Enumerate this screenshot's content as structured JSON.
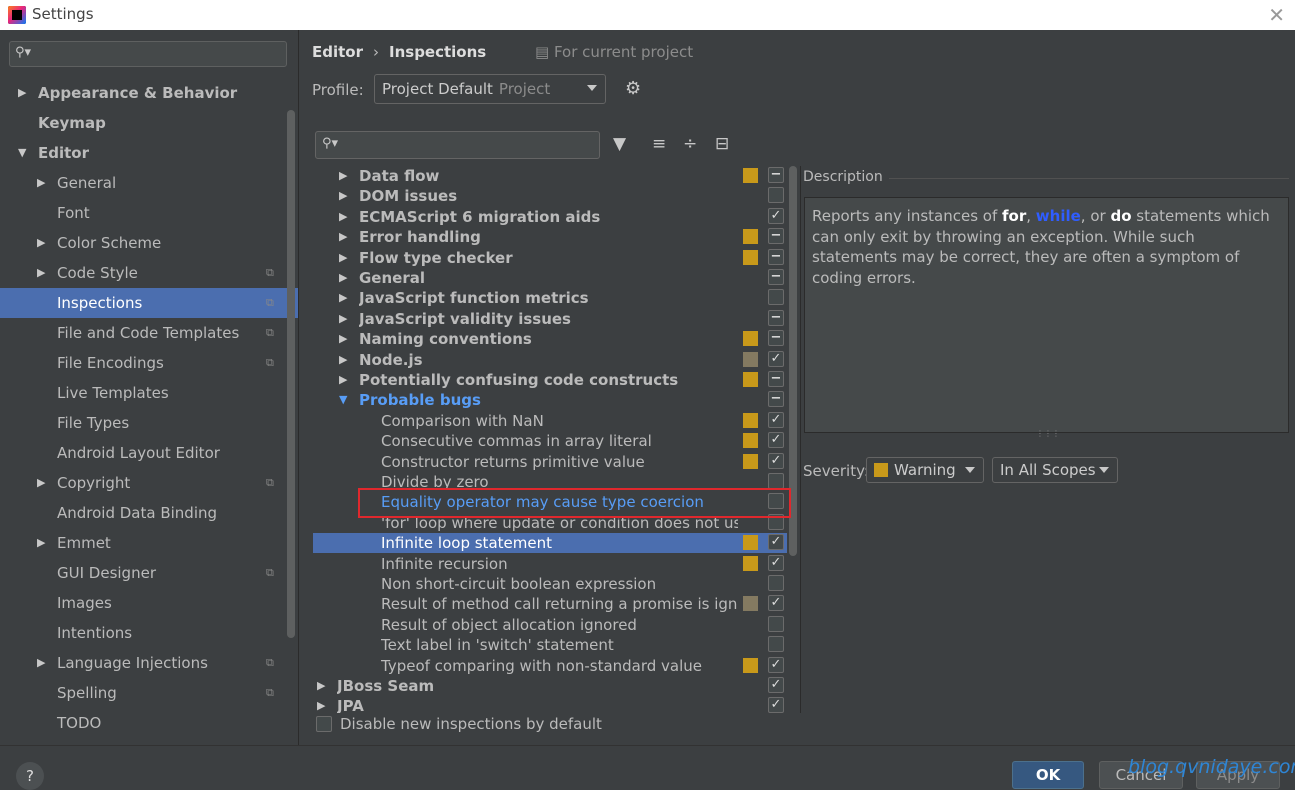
{
  "window": {
    "title": "Settings",
    "close_glyph": "✕"
  },
  "sidebar": {
    "search_placeholder": "",
    "items": [
      {
        "label": "Appearance & Behavior",
        "arrow": "▶",
        "bold": true,
        "indent": 0,
        "shared": false
      },
      {
        "label": "Keymap",
        "arrow": "",
        "bold": true,
        "indent": 0,
        "shared": false
      },
      {
        "label": "Editor",
        "arrow": "▼",
        "bold": true,
        "indent": 0,
        "shared": false
      },
      {
        "label": "General",
        "arrow": "▶",
        "bold": false,
        "indent": 1,
        "shared": false
      },
      {
        "label": "Font",
        "arrow": "",
        "bold": false,
        "indent": 1,
        "shared": false
      },
      {
        "label": "Color Scheme",
        "arrow": "▶",
        "bold": false,
        "indent": 1,
        "shared": false
      },
      {
        "label": "Code Style",
        "arrow": "▶",
        "bold": false,
        "indent": 1,
        "shared": true
      },
      {
        "label": "Inspections",
        "arrow": "",
        "bold": false,
        "indent": 1,
        "shared": true,
        "selected": true
      },
      {
        "label": "File and Code Templates",
        "arrow": "",
        "bold": false,
        "indent": 1,
        "shared": true
      },
      {
        "label": "File Encodings",
        "arrow": "",
        "bold": false,
        "indent": 1,
        "shared": true
      },
      {
        "label": "Live Templates",
        "arrow": "",
        "bold": false,
        "indent": 1,
        "shared": false
      },
      {
        "label": "File Types",
        "arrow": "",
        "bold": false,
        "indent": 1,
        "shared": false
      },
      {
        "label": "Android Layout Editor",
        "arrow": "",
        "bold": false,
        "indent": 1,
        "shared": false
      },
      {
        "label": "Copyright",
        "arrow": "▶",
        "bold": false,
        "indent": 1,
        "shared": true
      },
      {
        "label": "Android Data Binding",
        "arrow": "",
        "bold": false,
        "indent": 1,
        "shared": false
      },
      {
        "label": "Emmet",
        "arrow": "▶",
        "bold": false,
        "indent": 1,
        "shared": false
      },
      {
        "label": "GUI Designer",
        "arrow": "",
        "bold": false,
        "indent": 1,
        "shared": true
      },
      {
        "label": "Images",
        "arrow": "",
        "bold": false,
        "indent": 1,
        "shared": false
      },
      {
        "label": "Intentions",
        "arrow": "",
        "bold": false,
        "indent": 1,
        "shared": false
      },
      {
        "label": "Language Injections",
        "arrow": "▶",
        "bold": false,
        "indent": 1,
        "shared": true
      },
      {
        "label": "Spelling",
        "arrow": "",
        "bold": false,
        "indent": 1,
        "shared": true
      },
      {
        "label": "TODO",
        "arrow": "",
        "bold": false,
        "indent": 1,
        "shared": false
      }
    ]
  },
  "header": {
    "crumb_parent": "Editor",
    "crumb_sep": "›",
    "crumb_current": "Inspections",
    "scope_note": "For current project",
    "profile_label": "Profile:",
    "profile_value": "Project Default",
    "profile_kind": "Project"
  },
  "inspections": {
    "rows": [
      {
        "label": "Data flow",
        "level": 0,
        "arrow": "▶",
        "cat": true,
        "sev": "#c8991a",
        "chk": "mixed"
      },
      {
        "label": "DOM issues",
        "level": 0,
        "arrow": "▶",
        "cat": true,
        "sev": "",
        "chk": "off"
      },
      {
        "label": "ECMAScript 6 migration aids",
        "level": 0,
        "arrow": "▶",
        "cat": true,
        "sev": "",
        "chk": "on"
      },
      {
        "label": "Error handling",
        "level": 0,
        "arrow": "▶",
        "cat": true,
        "sev": "#c8991a",
        "chk": "mixed"
      },
      {
        "label": "Flow type checker",
        "level": 0,
        "arrow": "▶",
        "cat": true,
        "sev": "#c8991a",
        "chk": "mixed"
      },
      {
        "label": "General",
        "level": 0,
        "arrow": "▶",
        "cat": true,
        "sev": "",
        "chk": "mixed"
      },
      {
        "label": "JavaScript function metrics",
        "level": 0,
        "arrow": "▶",
        "cat": true,
        "sev": "",
        "chk": "off"
      },
      {
        "label": "JavaScript validity issues",
        "level": 0,
        "arrow": "▶",
        "cat": true,
        "sev": "",
        "chk": "mixed"
      },
      {
        "label": "Naming conventions",
        "level": 0,
        "arrow": "▶",
        "cat": true,
        "sev": "#c8991a",
        "chk": "mixed"
      },
      {
        "label": "Node.js",
        "level": 0,
        "arrow": "▶",
        "cat": true,
        "sev": "#847a61",
        "chk": "on"
      },
      {
        "label": "Potentially confusing code constructs",
        "level": 0,
        "arrow": "▶",
        "cat": true,
        "sev": "#c8991a",
        "chk": "mixed"
      },
      {
        "label": "Probable bugs",
        "level": 0,
        "arrow": "▼",
        "cat": true,
        "blue": true,
        "sev": "",
        "chk": "mixed"
      },
      {
        "label": "Comparison with NaN",
        "level": 1,
        "arrow": "",
        "cat": false,
        "sev": "#c8991a",
        "chk": "on"
      },
      {
        "label": "Consecutive commas in array literal",
        "level": 1,
        "arrow": "",
        "cat": false,
        "sev": "#c8991a",
        "chk": "on"
      },
      {
        "label": "Constructor returns primitive value",
        "level": 1,
        "arrow": "",
        "cat": false,
        "sev": "#c8991a",
        "chk": "on"
      },
      {
        "label": "Divide by zero",
        "level": 1,
        "arrow": "",
        "cat": false,
        "sev": "",
        "chk": "off"
      },
      {
        "label": "Equality operator may cause type coercion",
        "level": 1,
        "arrow": "",
        "cat": false,
        "blue": true,
        "sev": "",
        "chk": "off"
      },
      {
        "label": "'for' loop where update or condition does not use lo",
        "level": 1,
        "arrow": "",
        "cat": false,
        "sev": "",
        "chk": "off"
      },
      {
        "label": "Infinite loop statement",
        "level": 1,
        "arrow": "",
        "cat": false,
        "sel": true,
        "sev": "#c8991a",
        "chk": "on"
      },
      {
        "label": "Infinite recursion",
        "level": 1,
        "arrow": "",
        "cat": false,
        "sev": "#c8991a",
        "chk": "on"
      },
      {
        "label": "Non short-circuit boolean expression",
        "level": 1,
        "arrow": "",
        "cat": false,
        "sev": "",
        "chk": "off"
      },
      {
        "label": "Result of method call returning a promise is ignorec",
        "level": 1,
        "arrow": "",
        "cat": false,
        "sev": "#847a61",
        "chk": "on"
      },
      {
        "label": "Result of object allocation ignored",
        "level": 1,
        "arrow": "",
        "cat": false,
        "sev": "",
        "chk": "off"
      },
      {
        "label": "Text label in 'switch' statement",
        "level": 1,
        "arrow": "",
        "cat": false,
        "sev": "",
        "chk": "off"
      },
      {
        "label": "Typeof comparing with non-standard value",
        "level": 1,
        "arrow": "",
        "cat": false,
        "sev": "#c8991a",
        "chk": "on"
      },
      {
        "label": "JBoss Seam",
        "level": -1,
        "arrow": "▶",
        "cat": true,
        "sev": "",
        "chk": "on"
      },
      {
        "label": "JPA",
        "level": -1,
        "arrow": "▶",
        "cat": true,
        "sev": "",
        "chk": "on"
      }
    ],
    "disable_label": "Disable new inspections by default"
  },
  "description": {
    "title": "Description",
    "p1": "Reports any instances of ",
    "kw_for": "for",
    "p2": ", ",
    "kw_while": "while",
    "p3": ", or ",
    "kw_do": "do",
    "p4": " statements which can only exit by throwing an exception. While such statements may be correct, they are often a symptom of coding errors."
  },
  "severity": {
    "label": "Severity:",
    "value": "Warning",
    "scope": "In All Scopes",
    "color": "#c8991a"
  },
  "footer": {
    "help": "?",
    "ok": "OK",
    "cancel": "Cancel",
    "apply": "Apply",
    "watermark": "blog.qvnidaye.com"
  }
}
